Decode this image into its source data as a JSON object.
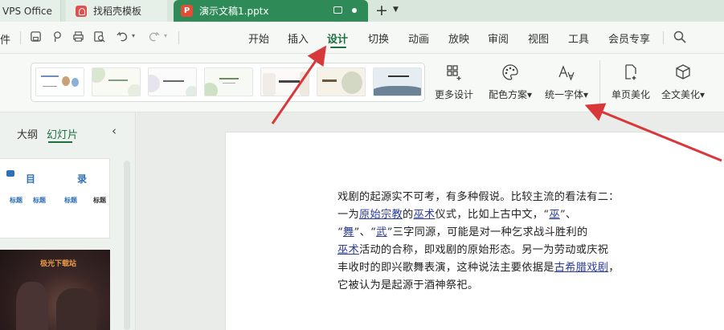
{
  "tabs": {
    "wps_label": "VPS Office",
    "find_label": "找稻壳模板",
    "doc_label": "演示文稿1.pptx",
    "doc_icon_letter": "P"
  },
  "menubar": {
    "file_label": "件",
    "items": [
      "开始",
      "插入",
      "设计",
      "切换",
      "动画",
      "放映",
      "审阅",
      "视图",
      "工具",
      "会员专享"
    ],
    "active": "设计"
  },
  "ribbon": {
    "more_design": "更多设计",
    "color_scheme": "配色方案",
    "unify_font": "统一字体",
    "page_beautify": "单页美化",
    "full_beautify": "全文美化"
  },
  "left_panel": {
    "tab_outline": "大纲",
    "tab_slides": "幻灯片",
    "slide1_title_a": "目",
    "slide1_title_b": "录",
    "slide1_mini": "标题",
    "slide2_title": "极光下载站"
  },
  "slide_text": {
    "l1": "戏剧的起源实不可考，有多种假说。比较主流的看法有二：",
    "l2a": "一为",
    "l2_link1": "原始宗教",
    "l2b": "的",
    "l2_link2": "巫术",
    "l2c": "仪式，比如上古中文，“",
    "l2_link3": "巫",
    "l2d": "”、",
    "l3a": "“",
    "l3_link1": "舞",
    "l3b": "”、“",
    "l3_link2": "武",
    "l3c": "”三字同源，可能是对一种乞求战斗胜利的",
    "l4_link1": "巫术",
    "l4b": "活动的合称，即戏剧的原始形态。另一为劳动或庆祝",
    "l5a": "丰收时的即兴歌舞表演，这种说法主要依据是",
    "l5_link1": "古希腊戏剧",
    "l5b": "，",
    "l6": "它被认为是起源于酒神祭祀。"
  },
  "colors": {
    "accent": "#2e8b57",
    "active_menu": "#1d6f42",
    "arrow": "#d8383a",
    "link": "#2b3d9c"
  }
}
